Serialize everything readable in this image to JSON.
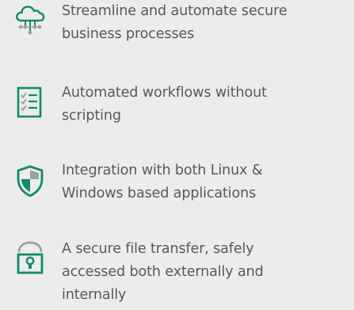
{
  "colors": {
    "background": "#ececec",
    "text": "#555a5d",
    "icon_green": "#0f8c6c",
    "lock_gray": "#9ea1a3"
  },
  "features": [
    {
      "icon": "cloud-network-icon",
      "lines": [
        "Streamline and automate secure",
        "business processes"
      ]
    },
    {
      "icon": "checklist-icon",
      "lines": [
        "Automated workflows without",
        "scripting"
      ]
    },
    {
      "icon": "shield-icon",
      "lines": [
        "Integration with both Linux &",
        "Windows based applications"
      ]
    },
    {
      "icon": "padlock-icon",
      "lines": [
        "A secure file transfer, safely",
        "accessed both externally and",
        "internally"
      ]
    }
  ]
}
